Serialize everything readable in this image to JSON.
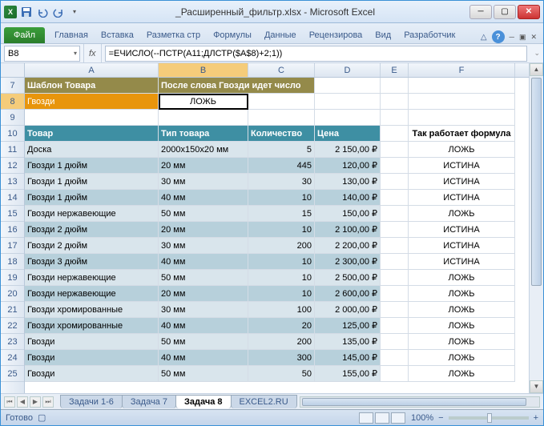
{
  "window": {
    "title": "_Расширенный_фильтр.xlsx - Microsoft Excel"
  },
  "ribbon": {
    "file": "Файл",
    "tabs": [
      "Главная",
      "Вставка",
      "Разметка стр",
      "Формулы",
      "Данные",
      "Рецензирова",
      "Вид",
      "Разработчик"
    ]
  },
  "namebox": "B8",
  "formula": "=ЕЧИСЛО(--ПСТР(A11;ДЛСТР($A$8)+2;1))",
  "columns": [
    "A",
    "B",
    "C",
    "D",
    "E",
    "F"
  ],
  "visible_row_numbers": [
    7,
    8,
    9,
    10,
    11,
    12,
    13,
    14,
    15,
    16,
    17,
    18,
    19,
    20,
    21,
    22,
    23,
    24,
    25
  ],
  "header7": {
    "a": "Шаблон Товара",
    "b": "После слова Гвозди идет число"
  },
  "row8": {
    "a": "Гвозди",
    "b": "ЛОЖЬ"
  },
  "header10": {
    "a": "Товар",
    "b": "Тип товара",
    "c": "Количество",
    "d": "Цена",
    "f": "Так работает формула"
  },
  "data_rows": [
    {
      "a": "Доска",
      "b": "2000х150х20 мм",
      "c": "5",
      "d": "2 150,00 ₽",
      "f": "ЛОЖЬ"
    },
    {
      "a": "Гвозди 1 дюйм",
      "b": "20 мм",
      "c": "445",
      "d": "120,00 ₽",
      "f": "ИСТИНА"
    },
    {
      "a": "Гвозди 1 дюйм",
      "b": "30 мм",
      "c": "30",
      "d": "130,00 ₽",
      "f": "ИСТИНА"
    },
    {
      "a": "Гвозди 1 дюйм",
      "b": "40 мм",
      "c": "10",
      "d": "140,00 ₽",
      "f": "ИСТИНА"
    },
    {
      "a": "Гвозди нержавеющие",
      "b": "50 мм",
      "c": "15",
      "d": "150,00 ₽",
      "f": "ЛОЖЬ"
    },
    {
      "a": "Гвозди 2 дюйм",
      "b": "20 мм",
      "c": "10",
      "d": "2 100,00 ₽",
      "f": "ИСТИНА"
    },
    {
      "a": "Гвозди 2 дюйм",
      "b": "30 мм",
      "c": "200",
      "d": "2 200,00 ₽",
      "f": "ИСТИНА"
    },
    {
      "a": "Гвозди 3 дюйм",
      "b": "40 мм",
      "c": "10",
      "d": "2 300,00 ₽",
      "f": "ИСТИНА"
    },
    {
      "a": "Гвозди нержавеющие",
      "b": "50 мм",
      "c": "10",
      "d": "2 500,00 ₽",
      "f": "ЛОЖЬ"
    },
    {
      "a": "Гвозди нержавеющие",
      "b": "20 мм",
      "c": "10",
      "d": "2 600,00 ₽",
      "f": "ЛОЖЬ"
    },
    {
      "a": "Гвозди хромированные",
      "b": "30 мм",
      "c": "100",
      "d": "2 000,00 ₽",
      "f": "ЛОЖЬ"
    },
    {
      "a": "Гвозди хромированные",
      "b": "40 мм",
      "c": "20",
      "d": "125,00 ₽",
      "f": "ЛОЖЬ"
    },
    {
      "a": "Гвозди",
      "b": "50 мм",
      "c": "200",
      "d": "135,00 ₽",
      "f": "ЛОЖЬ"
    },
    {
      "a": "Гвозди",
      "b": "40 мм",
      "c": "300",
      "d": "145,00 ₽",
      "f": "ЛОЖЬ"
    },
    {
      "a": "Гвозди",
      "b": "50 мм",
      "c": "50",
      "d": "155,00 ₽",
      "f": "ЛОЖЬ"
    }
  ],
  "sheet_tabs": [
    "Задачи 1-6",
    "Задача 7",
    "Задача 8",
    "EXCEL2.RU"
  ],
  "active_tab_index": 2,
  "status": {
    "ready": "Готово",
    "zoom": "100%",
    "zoom_minus": "−",
    "zoom_plus": "+"
  }
}
